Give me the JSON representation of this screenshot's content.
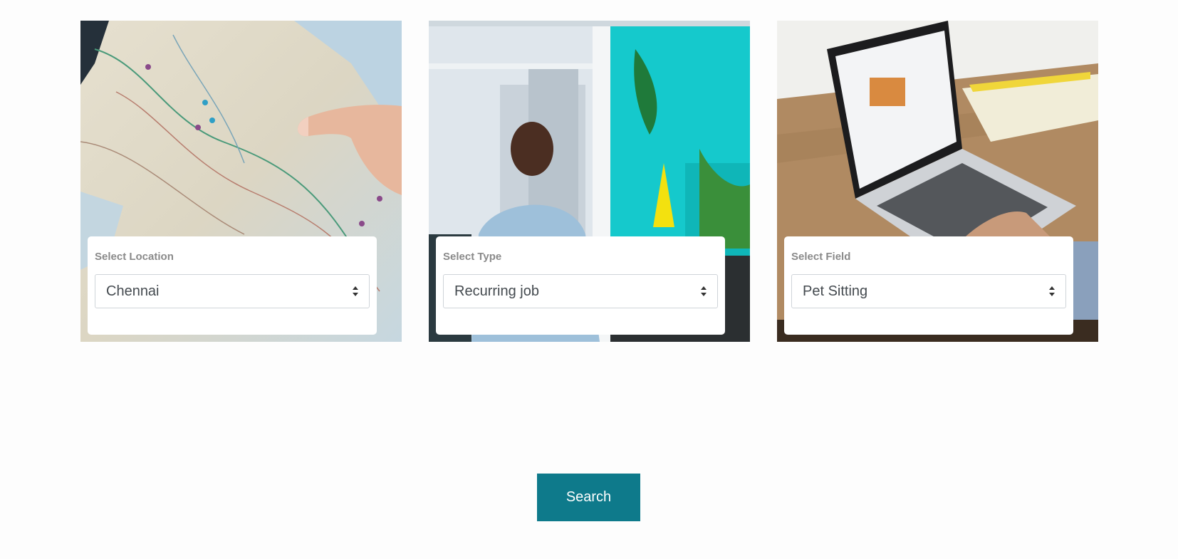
{
  "filters": [
    {
      "label": "Select Location",
      "selected": "Chennai",
      "image": "map-photo"
    },
    {
      "label": "Select Type",
      "selected": "Recurring job",
      "image": "office-worker-photo"
    },
    {
      "label": "Select Field",
      "selected": "Pet Sitting",
      "image": "laptop-photo"
    }
  ],
  "search": {
    "label": "Search"
  },
  "colors": {
    "accent": "#0e7a8b",
    "panel": "#ffffff",
    "label": "#8a8a8a"
  },
  "icons": {
    "select_arrows": "sort-arrows-icon"
  }
}
